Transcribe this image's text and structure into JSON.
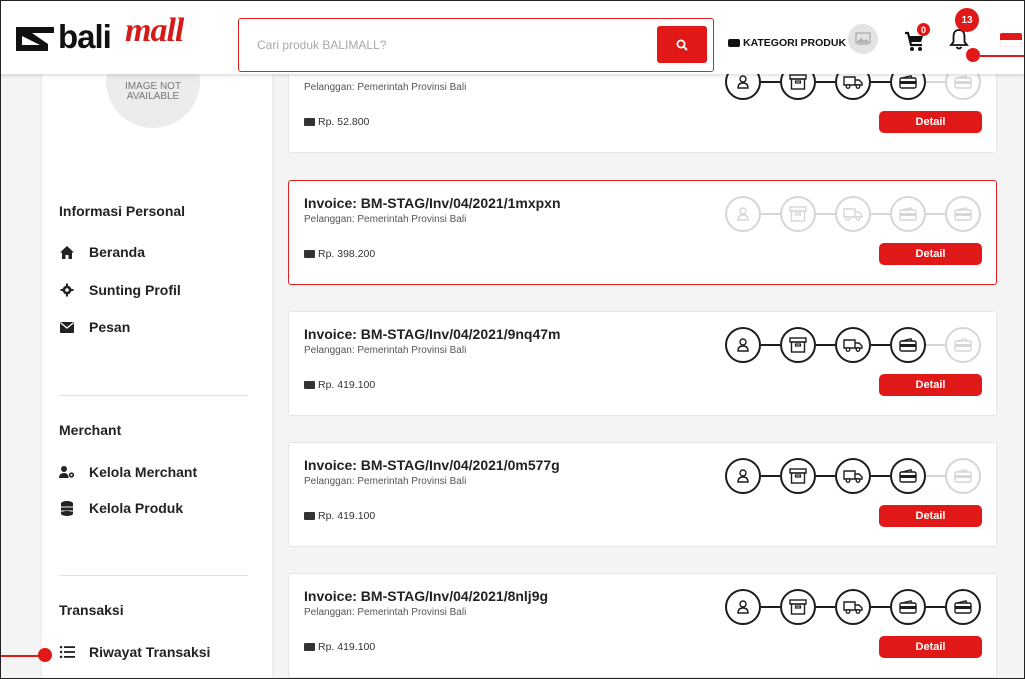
{
  "header": {
    "logo_bali": "bali",
    "logo_mall": "mall",
    "search_placeholder": "Cari produk BALIMALL?",
    "kategori_label": "KATEGORI PRODUK",
    "cart_count": "0",
    "notif_count": "13"
  },
  "sidebar": {
    "avatar_text": "IMAGE NOT AVAILABLE",
    "sections": [
      {
        "title": "Informasi Personal",
        "items": [
          {
            "label": "Beranda",
            "icon": "home-icon"
          },
          {
            "label": "Sunting Profil",
            "icon": "gear-icon"
          },
          {
            "label": "Pesan",
            "icon": "envelope-icon"
          }
        ]
      },
      {
        "title": "Merchant",
        "items": [
          {
            "label": "Kelola Merchant",
            "icon": "user-gear-icon"
          },
          {
            "label": "Kelola Produk",
            "icon": "database-icon"
          }
        ]
      },
      {
        "title": "Transaksi",
        "items": [
          {
            "label": "Riwayat Transaksi",
            "icon": "list-icon"
          }
        ]
      }
    ]
  },
  "invoices": [
    {
      "title": "",
      "customer": "Pelanggan: Pemerintah Provinsi Bali",
      "amount": "Rp. 52.800",
      "detail_label": "Detail",
      "steps_done": 4,
      "selected": false
    },
    {
      "title": "Invoice: BM-STAG/Inv/04/2021/1mxpxn",
      "customer": "Pelanggan: Pemerintah Provinsi Bali",
      "amount": "Rp. 398.200",
      "detail_label": "Detail",
      "steps_done": 0,
      "selected": true
    },
    {
      "title": "Invoice: BM-STAG/Inv/04/2021/9nq47m",
      "customer": "Pelanggan: Pemerintah Provinsi Bali",
      "amount": "Rp. 419.100",
      "detail_label": "Detail",
      "steps_done": 4,
      "selected": false
    },
    {
      "title": "Invoice: BM-STAG/Inv/04/2021/0m577g",
      "customer": "Pelanggan: Pemerintah Provinsi Bali",
      "amount": "Rp. 419.100",
      "detail_label": "Detail",
      "steps_done": 4,
      "selected": false
    },
    {
      "title": "Invoice: BM-STAG/Inv/04/2021/8nlj9g",
      "customer": "Pelanggan: Pemerintah Provinsi Bali",
      "amount": "Rp. 419.100",
      "detail_label": "Detail",
      "steps_done": 5,
      "selected": false
    }
  ],
  "colors": {
    "accent": "#e01818",
    "step_done": "#1d1d1d",
    "step_pending": "#d6d6d6"
  }
}
